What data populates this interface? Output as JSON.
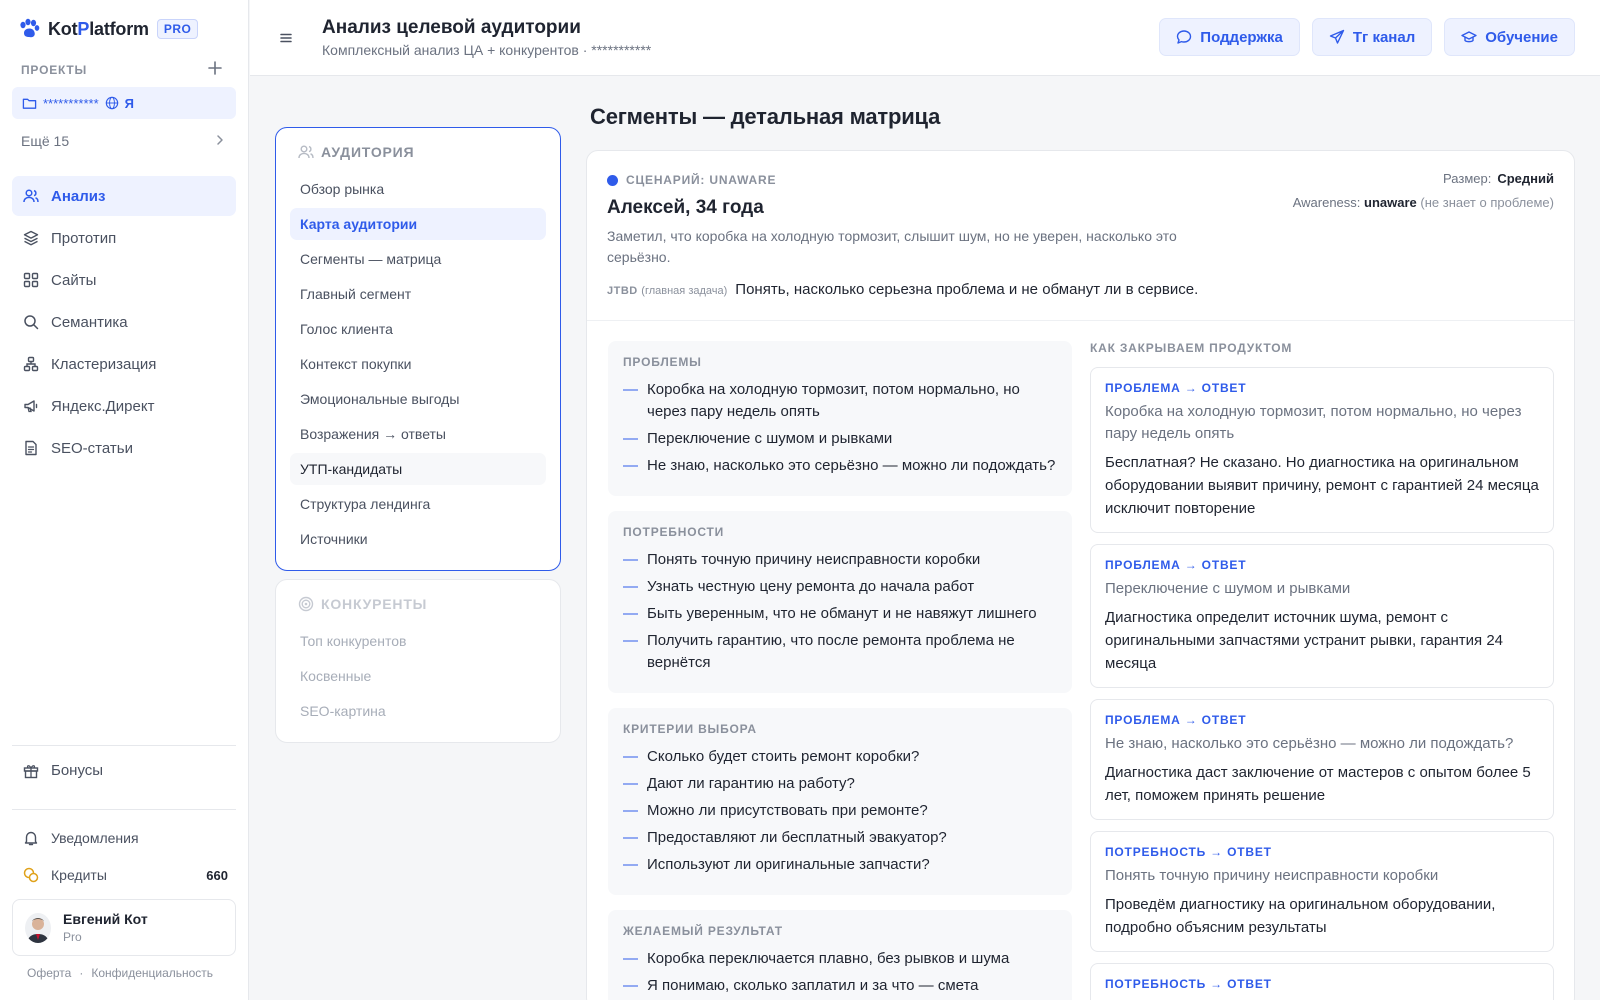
{
  "app": {
    "logo_part1": "Kot",
    "logo_accent": "P",
    "logo_part2": "latform",
    "plan_badge": "PRO"
  },
  "sidebar": {
    "projects_label": "ПРОЕКТЫ",
    "project": {
      "name": "***********",
      "user": "Я"
    },
    "more": "Ещё 15",
    "nav": [
      {
        "label": "Анализ",
        "icon": "users-icon",
        "active": true
      },
      {
        "label": "Прототип",
        "icon": "layers-icon"
      },
      {
        "label": "Сайты",
        "icon": "grid-icon"
      },
      {
        "label": "Семантика",
        "icon": "search-icon"
      },
      {
        "label": "Кластеризация",
        "icon": "cluster-icon"
      },
      {
        "label": "Яндекс.Директ",
        "icon": "megaphone-icon"
      },
      {
        "label": "SEO-статьи",
        "icon": "document-icon"
      }
    ],
    "bonus": "Бонусы",
    "notifications": "Уведомления",
    "credits_label": "Кредиты",
    "credits_value": "660",
    "user": {
      "name": "Евгений Кот",
      "plan": "Pro"
    },
    "footer": {
      "offer": "Оферта",
      "sep": "·",
      "privacy": "Конфиденциальность"
    }
  },
  "header": {
    "title": "Анализ целевой аудитории",
    "subtitle": "Комплексный анализ ЦА + конкурентов · ***********",
    "buttons": [
      {
        "label": "Поддержка",
        "icon": "chat-icon"
      },
      {
        "label": "Тг канал",
        "icon": "send-icon"
      },
      {
        "label": "Обучение",
        "icon": "graduation-icon"
      }
    ]
  },
  "subnav": {
    "audience_title": "АУДИТОРИЯ",
    "audience_items": [
      "Обзор рынка",
      "Карта аудитории",
      "Сегменты — матрица",
      "Главный сегмент",
      "Голос клиента",
      "Контекст покупки",
      "Эмоциональные выгоды",
      "Возражения → ответы",
      "УТП-кандидаты",
      "Структура лендинга",
      "Источники"
    ],
    "audience_active_index": 1,
    "audience_hover_index": 8,
    "competitors_title": "КОНКУРЕНТЫ",
    "competitors_items": [
      "Топ конкурентов",
      "Косвенные",
      "SEO-картина"
    ]
  },
  "main": {
    "title": "Сегменты — детальная матрица",
    "segment": {
      "scenario": "СЦЕНАРИЙ: UNAWARE",
      "persona": "Алексей, 34 года",
      "description": "Заметил, что коробка на холодную тормозит, слышит шум, но не уверен, насколько это серьёзно.",
      "jtbd_label": "JTBD",
      "jtbd_hint": "(главная задача)",
      "jtbd_text": "Понять, насколько серьезна проблема и не обманут ли в сервисе.",
      "size_label": "Размер:",
      "size_value": "Средний",
      "awareness_label": "Awareness:",
      "awareness_value": "unaware",
      "awareness_hint": "(не знает о проблеме)"
    },
    "blocks": [
      {
        "title": "ПРОБЛЕМЫ",
        "items": [
          "Коробка на холодную тормозит, потом нормально, но через пару недель опять",
          "Переключение с шумом и рывками",
          "Не знаю, насколько это серьёзно — можно ли подождать?"
        ]
      },
      {
        "title": "ПОТРЕБНОСТИ",
        "items": [
          "Понять точную причину неисправности коробки",
          "Узнать честную цену ремонта до начала работ",
          "Быть уверенным, что не обманут и не навяжут лишнего",
          "Получить гарантию, что после ремонта проблема не вернётся"
        ]
      },
      {
        "title": "КРИТЕРИИ ВЫБОРА",
        "items": [
          "Сколько будет стоить ремонт коробки?",
          "Дают ли гарантию на работу?",
          "Можно ли присутствовать при ремонте?",
          "Предоставляют ли бесплатный эвакуатор?",
          "Используют ли оригинальные запчасти?"
        ]
      },
      {
        "title": "ЖЕЛАЕМЫЙ РЕЗУЛЬТАТ",
        "items": [
          "Коробка переключается плавно, без рывков и шума",
          "Я понимаю, сколько заплатил и за что — смета"
        ]
      }
    ],
    "answers_title": "КАК ЗАКРЫВАЕМ ПРОДУКТОМ",
    "answers": [
      {
        "tag": "ПРОБЛЕМА → ОТВЕТ",
        "q": "Коробка на холодную тормозит, потом нормально, но через пару недель опять",
        "a": "Бесплатная? Не сказано. Но диагностика на оригинальном оборудовании выявит причину, ремонт с гарантией 24 месяца исключит повторение"
      },
      {
        "tag": "ПРОБЛЕМА → ОТВЕТ",
        "q": "Переключение с шумом и рывками",
        "a": "Диагностика определит источник шума, ремонт с оригинальными запчастями устранит рывки, гарантия 24 месяца"
      },
      {
        "tag": "ПРОБЛЕМА → ОТВЕТ",
        "q": "Не знаю, насколько это серьёзно — можно ли подождать?",
        "a": "Диагностика даст заключение от мастеров с опытом более 5 лет, поможем принять решение"
      },
      {
        "tag": "ПОТРЕБНОСТЬ → ОТВЕТ",
        "q": "Понять точную причину неисправности коробки",
        "a": "Проведём диагностику на оригинальном оборудовании, подробно объясним результаты"
      },
      {
        "tag": "ПОТРЕБНОСТЬ → ОТВЕТ",
        "q": "",
        "a": ""
      }
    ]
  },
  "colors": {
    "accent": "#2f5bea",
    "accent_bg": "#eef2ff",
    "text": "#1f2430",
    "muted": "#8a909c"
  }
}
